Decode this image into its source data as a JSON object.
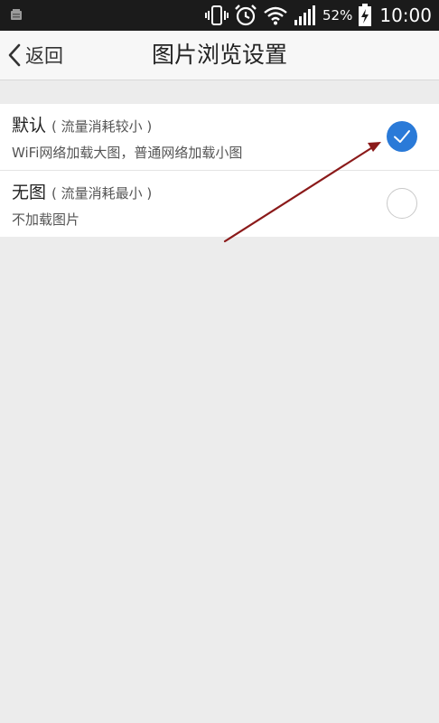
{
  "status_bar": {
    "battery_percent": "52%",
    "time": "10:00"
  },
  "nav": {
    "back_label": "返回",
    "title": "图片浏览设置"
  },
  "options": [
    {
      "name": "默认",
      "hint": "( 流量消耗较小 )",
      "description": "WiFi网络加载大图，普通网络加载小图",
      "selected": true
    },
    {
      "name": "无图",
      "hint": "( 流量消耗最小 )",
      "description": "不加载图片",
      "selected": false
    }
  ],
  "colors": {
    "accent": "#2a7ad8",
    "arrow": "#8b1a1a",
    "background": "#ececec",
    "status_bar": "#1b1b1b"
  },
  "icons": {
    "status_left": "notification-icon",
    "vibrate": "vibrate-icon",
    "alarm": "alarm-icon",
    "wifi": "wifi-icon",
    "signal": "signal-icon",
    "battery": "battery-charging-icon",
    "back": "chevron-left-icon",
    "checked": "check-icon"
  }
}
